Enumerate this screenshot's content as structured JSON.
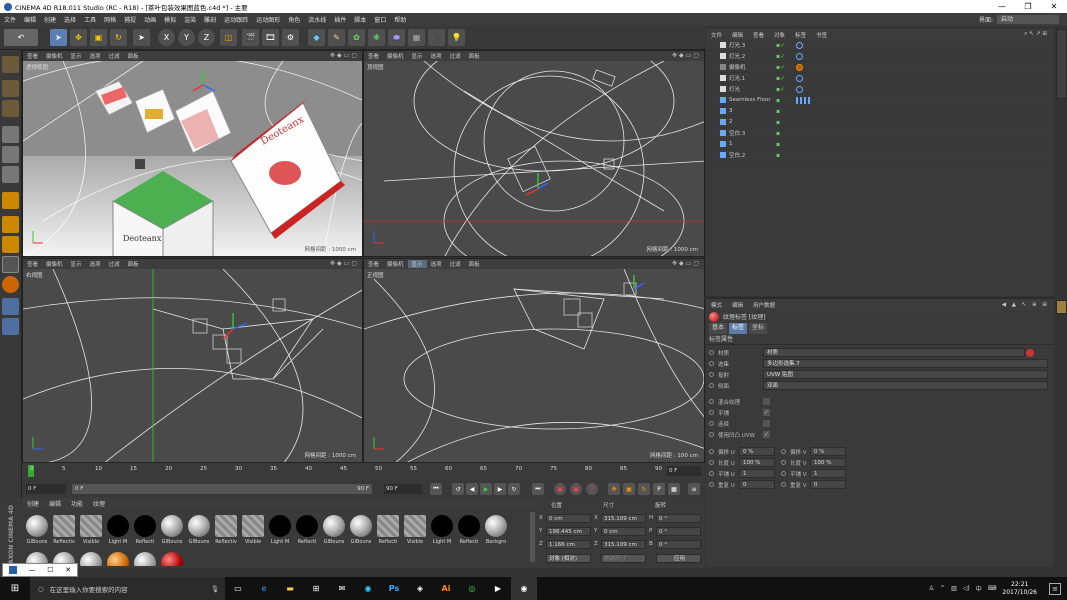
{
  "window": {
    "title": "CINEMA 4D R18.011 Studio (RC - R18) - [茶叶包装效果图蓝色.c4d *] - 主要",
    "min": "—",
    "max": "❐",
    "close": "✕"
  },
  "menu": [
    "文件",
    "编辑",
    "创建",
    "选择",
    "工具",
    "网格",
    "捕捉",
    "动画",
    "模拟",
    "渲染",
    "雕刻",
    "运动跟踪",
    "运动图形",
    "角色",
    "流水线",
    "插件",
    "脚本",
    "窗口",
    "帮助"
  ],
  "layout": {
    "label": "界面:",
    "value": "启动"
  },
  "viewports": [
    {
      "menu": [
        "查看",
        "摄像机",
        "显示",
        "选项",
        "过滤",
        "面板"
      ],
      "label": "透视视图",
      "grid": "网格间距 : 1000 cm"
    },
    {
      "menu": [
        "查看",
        "摄像机",
        "显示",
        "选项",
        "过滤",
        "面板"
      ],
      "label": "顶视图",
      "grid": "网格间距 : 1000 cm"
    },
    {
      "menu": [
        "查看",
        "摄像机",
        "显示",
        "选项",
        "过滤",
        "面板"
      ],
      "label": "右视图",
      "grid": "网格间距 : 1000 cm"
    },
    {
      "menu": [
        "查看",
        "摄像机",
        "显示",
        "选项",
        "过滤",
        "面板"
      ],
      "label": "正视图",
      "grid": "网格间距 : 100 cm"
    }
  ],
  "objects": {
    "menu": [
      "文件",
      "编辑",
      "查看",
      "对象",
      "标签",
      "书签"
    ],
    "items": [
      {
        "name": "灯光.3"
      },
      {
        "name": "灯光.2"
      },
      {
        "name": "摄像机"
      },
      {
        "name": "灯光.1"
      },
      {
        "name": "灯光"
      },
      {
        "name": "Seamless Floor"
      },
      {
        "name": "3"
      },
      {
        "name": "2"
      },
      {
        "name": "空白.3"
      },
      {
        "name": "1"
      },
      {
        "name": "空白.2"
      }
    ]
  },
  "attributes": {
    "menu": [
      "模式",
      "编辑",
      "用户数据"
    ],
    "title": "纹理标签 [纹理]",
    "tabs": [
      "基本",
      "标签",
      "坐标"
    ],
    "section": "标签属性",
    "rows": [
      {
        "label": "材质",
        "value": "材质"
      },
      {
        "label": "选集",
        "value": "多边形选集.7"
      },
      {
        "label": "投射",
        "value": "UVW 贴图"
      },
      {
        "label": "侧面",
        "value": "双面"
      }
    ],
    "checks": [
      {
        "label": "混合纹理",
        "checked": ""
      },
      {
        "label": "平铺",
        "checked": "✓"
      },
      {
        "label": "连续",
        "checked": ""
      },
      {
        "label": "使用凹凸 UVW",
        "checked": "✓"
      }
    ],
    "pairs": [
      {
        "l": "偏移 U",
        "lv": "0 %",
        "r": "偏移 V",
        "rv": "0 %"
      },
      {
        "l": "长度 U",
        "lv": "100 %",
        "r": "长度 V",
        "rv": "100 %"
      },
      {
        "l": "平铺 U",
        "lv": "1",
        "r": "平铺 V",
        "rv": "1"
      },
      {
        "l": "重复 U",
        "lv": "0",
        "r": "重复 V",
        "rv": "0"
      }
    ]
  },
  "timeline": {
    "ticks": [
      "0",
      "5",
      "10",
      "15",
      "20",
      "25",
      "30",
      "35",
      "40",
      "45",
      "50",
      "55",
      "60",
      "65",
      "70",
      "75",
      "80",
      "85",
      "90"
    ],
    "end": "0 F"
  },
  "transport": {
    "start": "0 F",
    "current": "0 F",
    "end_a": "90 F",
    "end_b": "90 F"
  },
  "materials": {
    "menu": [
      "创建",
      "编辑",
      "功能",
      "纹理"
    ],
    "items": [
      "GIBouns",
      "Reflectiv",
      "Visible",
      "Light M",
      "Reflecti",
      "GIBouns",
      "GIBouns",
      "Reflectiv",
      "Visible",
      "Light M",
      "Reflecti",
      "GIBouns",
      "GIBouns",
      "Reflecti",
      "Visible",
      "Light M",
      "Reflecti",
      "Backgro"
    ]
  },
  "coords": {
    "headers": [
      "位置",
      "尺寸",
      "旋转"
    ],
    "rows": [
      {
        "a": "X",
        "av": "0 cm",
        "b": "X",
        "bv": "315.109 cm",
        "c": "H",
        "cv": "0 °"
      },
      {
        "a": "Y",
        "av": "198.445 cm",
        "b": "Y",
        "bv": "0 cm",
        "c": "P",
        "cv": "0 °"
      },
      {
        "a": "Z",
        "av": "1.166 cm",
        "b": "Z",
        "bv": "315.109 cm",
        "c": "B",
        "cv": "0 °"
      }
    ],
    "mode": "对象 (相对)",
    "size_mode": "绝对尺寸",
    "apply": "应用"
  },
  "brand": "MAXON CINEMA 4D",
  "taskbar": {
    "search": "在这里输入你要搜索的内容",
    "time": "22:21",
    "date": "2017/10/26",
    "ime": "中"
  }
}
